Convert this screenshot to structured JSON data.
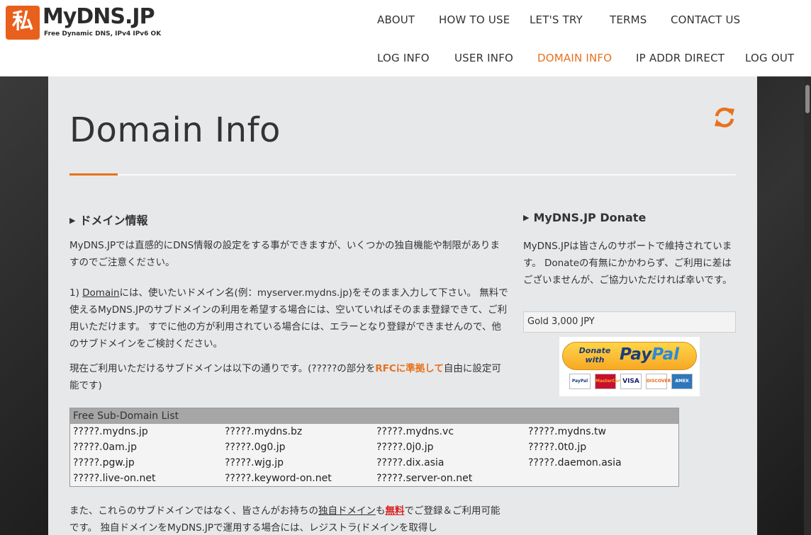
{
  "brand": {
    "name": "MyDNS.JP",
    "tagline": "Free Dynamic DNS, IPv4 IPv6 OK",
    "mark": "私"
  },
  "nav": {
    "row1": [
      "ABOUT",
      "HOW TO USE",
      "LET'S TRY",
      "TERMS",
      "CONTACT US"
    ],
    "row2": [
      "LOG INFO",
      "USER INFO",
      "DOMAIN INFO",
      "IP ADDR DIRECT",
      "LOG OUT"
    ],
    "active": "DOMAIN INFO"
  },
  "colors": {
    "accent": "#e8711c",
    "panel": "#e6e8ea"
  },
  "page": {
    "title": "Domain Info",
    "refresh_icon": "refresh-icon"
  },
  "main": {
    "heading": "ドメイン情報",
    "intro": "MyDNS.JPでは直感的にDNS情報の設定をする事ができますが、いくつかの独自機能や制限がありますのでご注意ください。",
    "p1_prefix": "1) ",
    "p1_link": "Domain",
    "p1_rest": "には、使いたいドメイン名(例：myserver.mydns.jp)をそのまま入力して下さい。 無料で使えるMyDNS.JPのサブドメインの利用を希望する場合には、空いていればそのまま登録できて、ご利用いただけます。 すでに他の方が利用されている場合には、エラーとなり登録ができませんので、他のサブドメインをご検討ください。",
    "p2_prefix": "現在ご利用いただけるサブドメインは以下の通りです。(?????の部分を",
    "p2_link": "RFCに準拠して",
    "p2_suffix": "自由に設定可能です)",
    "p3_a": "また、これらのサブドメインではなく、皆さんがお持ちの",
    "p3_b": "独自ドメイン",
    "p3_c": "も",
    "p3_d": "無料",
    "p3_e": "でご登録＆ご利用可能です。 独自ドメインをMyDNS.JPで運用する場合には、レジストラ(ドメインを取得し"
  },
  "subdomains": {
    "title": "Free Sub-Domain List",
    "items": [
      "?????.mydns.jp",
      "?????.mydns.bz",
      "?????.mydns.vc",
      "?????.mydns.tw",
      "?????.0am.jp",
      "?????.0g0.jp",
      "?????.0j0.jp",
      "?????.0t0.jp",
      "?????.pgw.jp",
      "?????.wjg.jp",
      "?????.dix.asia",
      "?????.daemon.asia",
      "?????.live-on.net",
      "?????.keyword-on.net",
      "?????.server-on.net"
    ]
  },
  "donate": {
    "heading": "MyDNS.JP Donate",
    "text": "MyDNS.JPは皆さんのサポートで維持されています。 Donateの有無にかかわらず、ご利用に差はございませんが、ご協力いただければ幸いです。",
    "selected": "Gold 3,000 JPY",
    "button_top": "Donate",
    "button_bottom": "with",
    "paypal_a": "Pay",
    "paypal_b": "Pal",
    "cards": [
      "PayPal",
      "MasterCard",
      "VISA",
      "DISCOVER",
      "AMEX"
    ]
  }
}
